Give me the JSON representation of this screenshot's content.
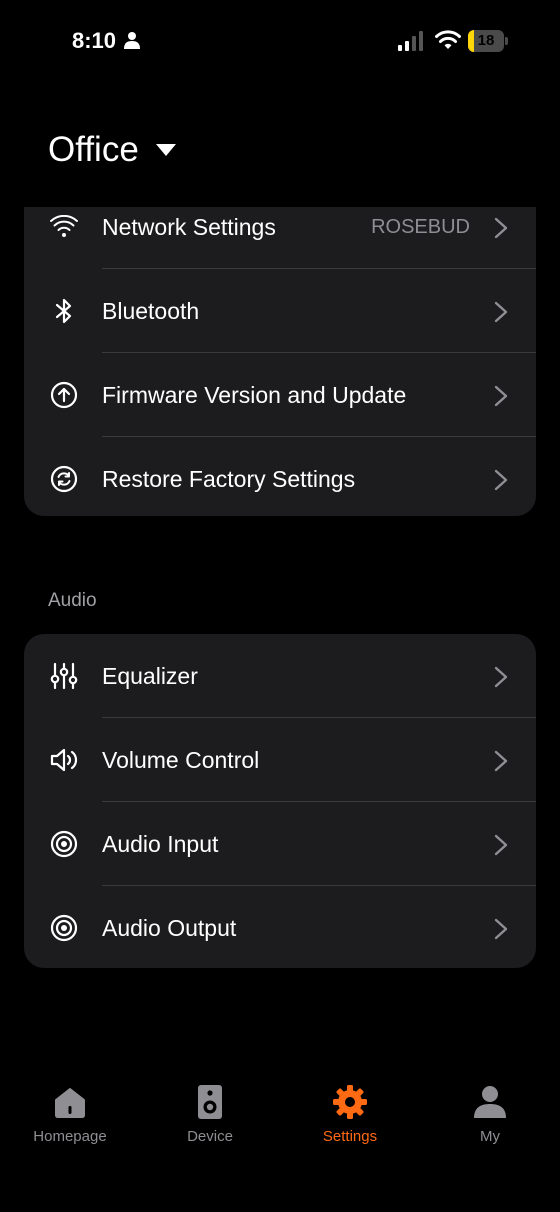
{
  "status_bar": {
    "time": "8:10",
    "battery": "18",
    "battery_level": 0.18
  },
  "header": {
    "title": "Office"
  },
  "system_group": {
    "items": [
      {
        "label": "Network Settings",
        "value": "ROSEBUD",
        "icon": "wifi-icon"
      },
      {
        "label": "Bluetooth",
        "icon": "bluetooth-icon"
      },
      {
        "label": "Firmware Version and Update",
        "icon": "upload-arrow-icon"
      },
      {
        "label": "Restore Factory Settings",
        "icon": "refresh-icon"
      }
    ]
  },
  "audio_group": {
    "label": "Audio",
    "items": [
      {
        "label": "Equalizer",
        "icon": "equalizer-icon"
      },
      {
        "label": "Volume Control",
        "icon": "speaker-icon"
      },
      {
        "label": "Audio Input",
        "icon": "target-icon"
      },
      {
        "label": "Audio Output",
        "icon": "target-icon"
      }
    ]
  },
  "tab_bar": {
    "tabs": [
      {
        "label": "Homepage",
        "icon": "home-icon"
      },
      {
        "label": "Device",
        "icon": "speaker-device-icon"
      },
      {
        "label": "Settings",
        "icon": "gear-icon",
        "active": true
      },
      {
        "label": "My",
        "icon": "person-icon"
      }
    ]
  },
  "colors": {
    "background": "#000000",
    "card": "#1c1c1e",
    "accent": "#ff6a13",
    "muted": "#8e8e93",
    "battery": "#ffd60a"
  }
}
